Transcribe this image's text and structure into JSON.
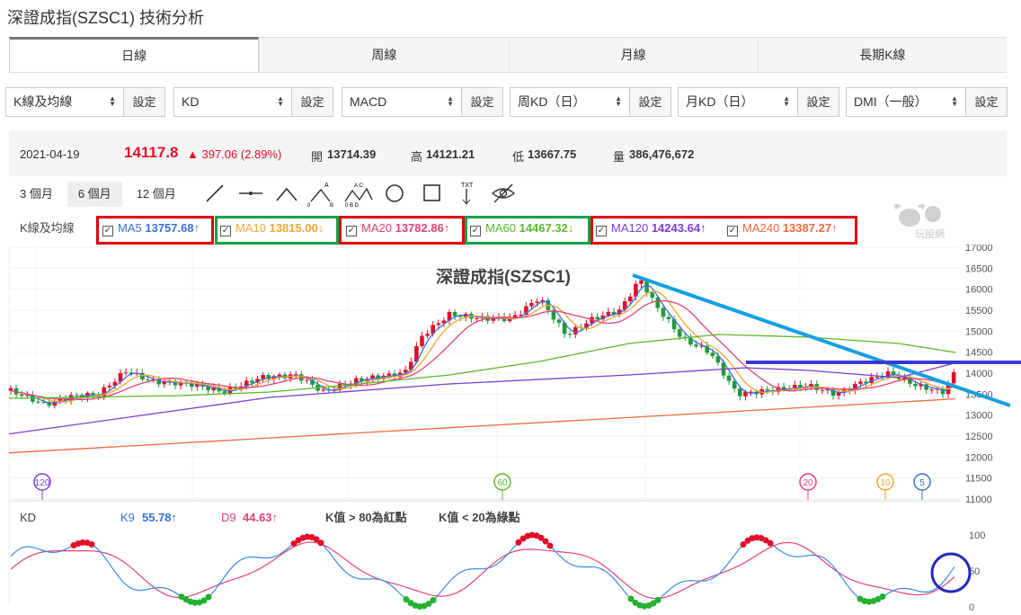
{
  "page": {
    "title": "深證成指(SZSC1) 技術分析"
  },
  "tabs": [
    {
      "label": "日線"
    },
    {
      "label": "周線"
    },
    {
      "label": "月線"
    },
    {
      "label": "長期K線"
    }
  ],
  "selectors": [
    {
      "value": "K線及均線",
      "button": "設定"
    },
    {
      "value": "KD",
      "button": "設定"
    },
    {
      "value": "MACD",
      "button": "設定"
    },
    {
      "value": "周KD（日）",
      "button": "設定"
    },
    {
      "value": "月KD（日）",
      "button": "設定"
    },
    {
      "value": "DMI（一般）",
      "button": "設定"
    }
  ],
  "quote": {
    "date": "2021-04-19",
    "price": "14117.8",
    "change": "▲ 397.06 (2.89%)",
    "open_label": "開",
    "open": "13714.39",
    "high_label": "高",
    "high": "14121.21",
    "low_label": "低",
    "low": "13667.75",
    "vol_label": "量",
    "vol": "386,476,672"
  },
  "ranges": [
    {
      "label": "3 個月"
    },
    {
      "label": "6 個月"
    },
    {
      "label": "12 個月"
    }
  ],
  "ma": {
    "label": "K線及均線",
    "items": [
      {
        "name": "MA5",
        "value": "13757.68↑",
        "color": "#3b6fd8"
      },
      {
        "name": "MA10",
        "value": "13815.00↓",
        "color": "#f2a530"
      },
      {
        "name": "MA20",
        "value": "13782.86↑",
        "color": "#e0427a"
      },
      {
        "name": "MA60",
        "value": "14467.32↓",
        "color": "#5cb82c"
      },
      {
        "name": "MA120",
        "value": "14243.64↑",
        "color": "#7b3fd1"
      },
      {
        "name": "MA240",
        "value": "13387.27↑",
        "color": "#f06a3c"
      }
    ]
  },
  "watermark": "玩股網",
  "chart": {
    "title": "深證成指(SZSC1)",
    "y_ticks": [
      "17000",
      "16500",
      "16000",
      "15500",
      "15000",
      "14500",
      "14000",
      "13500",
      "13000",
      "12500",
      "12000",
      "11500",
      "11000"
    ],
    "markers": [
      "120",
      "60",
      "20",
      "10",
      "5"
    ]
  },
  "kd": {
    "label": "KD",
    "k_label": "K9",
    "k_value": "55.78↑",
    "d_label": "D9",
    "d_value": "44.63↑",
    "note1": "K值 > 80為紅點",
    "note2": "K值 < 20為綠點",
    "y_ticks": [
      "100",
      "50",
      "0"
    ]
  },
  "chart_data": {
    "type": "line",
    "title": "深證成指(SZSC1)",
    "ylim": [
      11000,
      17000
    ],
    "series": [
      {
        "name": "MA240",
        "values": [
          12100,
          13387
        ]
      },
      {
        "name": "MA120",
        "values": [
          12550,
          14243
        ]
      }
    ]
  }
}
